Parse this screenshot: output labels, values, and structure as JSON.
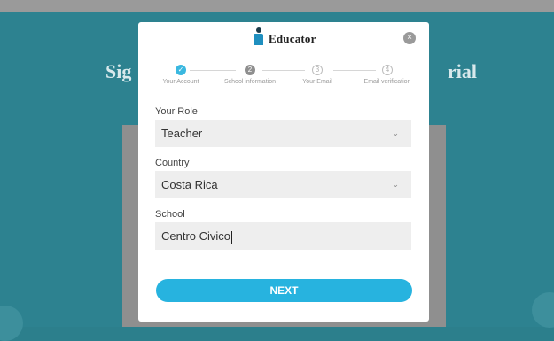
{
  "background": {
    "heading_left": "Sig",
    "heading_right": "rial"
  },
  "modal": {
    "brand": "Educator",
    "close_icon": "×",
    "steps": [
      {
        "label": "Your Account",
        "state": "done",
        "marker": "✓"
      },
      {
        "label": "School information",
        "state": "active",
        "marker": "2"
      },
      {
        "label": "Your Email",
        "state": "pending",
        "marker": "3"
      },
      {
        "label": "Email verification",
        "state": "pending",
        "marker": "4"
      }
    ],
    "role": {
      "label": "Your Role",
      "value": "Teacher"
    },
    "country": {
      "label": "Country",
      "value": "Costa Rica"
    },
    "school": {
      "label": "School",
      "value": "Centro Civico"
    },
    "next_label": "NEXT"
  },
  "colors": {
    "accent": "#27b3df",
    "background": "#2d8290"
  }
}
